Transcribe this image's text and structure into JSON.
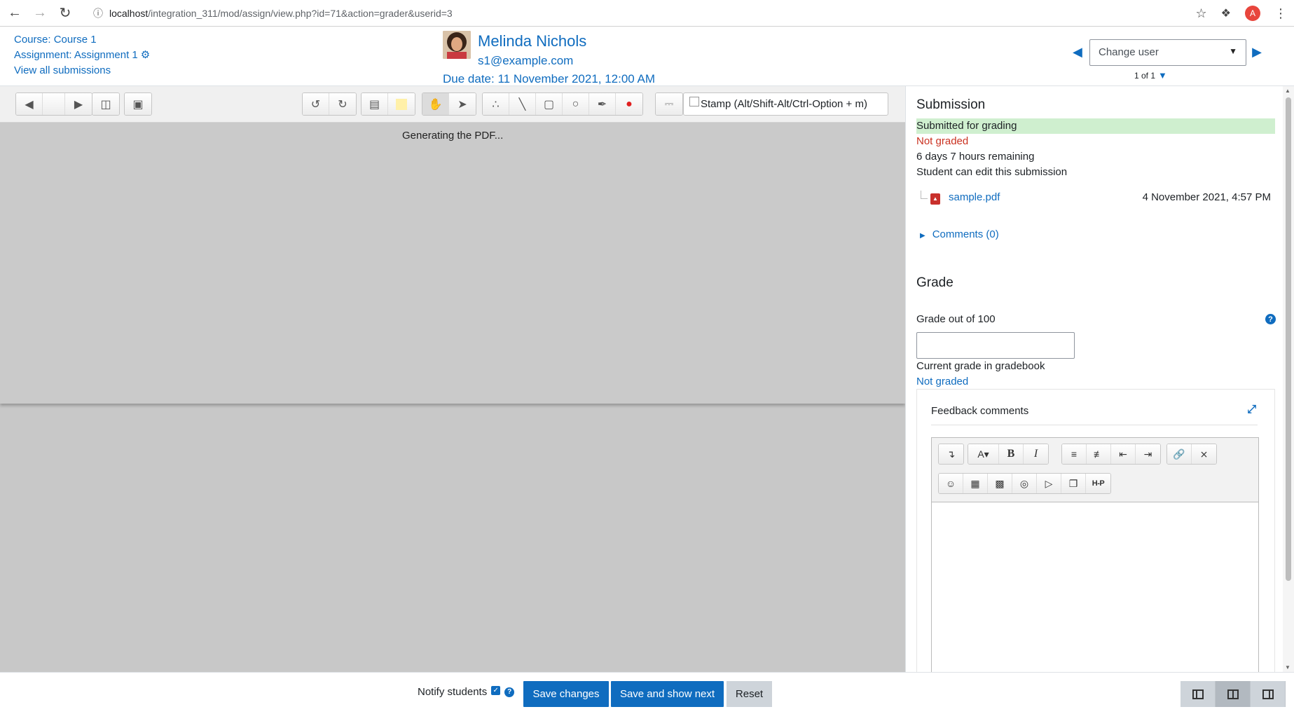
{
  "browser": {
    "url_host": "localhost",
    "url_path": "/integration_311/mod/assign/view.php?id=71&action=grader&userid=3",
    "profile_initial": "A"
  },
  "header": {
    "course_link": "Course: Course 1",
    "assignment_link": "Assignment: Assignment 1",
    "view_all": "View all submissions",
    "user_name": "Melinda Nichols",
    "user_email": "s1@example.com",
    "due_date": "Due date: 11 November 2021, 12:00 AM",
    "change_user_placeholder": "Change user",
    "user_count": "1 of 1"
  },
  "pdf": {
    "generating_message": "Generating the PDF...",
    "stamp_label": "Stamp (Alt/Shift-Alt/Ctrl-Option + m)"
  },
  "submission": {
    "heading": "Submission",
    "status_submitted": "Submitted for grading",
    "status_grading": "Not graded",
    "time_remaining": "6 days 7 hours remaining",
    "edit_status": "Student can edit this submission",
    "file_name": "sample.pdf",
    "file_date": "4 November 2021, 4:57 PM",
    "comments": "Comments (0)"
  },
  "grade": {
    "heading": "Grade",
    "grade_label": "Grade out of 100",
    "grade_value": "",
    "current_grade_label": "Current grade in gradebook",
    "current_grade_value": "Not graded",
    "feedback_title": "Feedback comments"
  },
  "footer": {
    "notify_label": "Notify students",
    "save_changes": "Save changes",
    "save_show_next": "Save and show next",
    "reset": "Reset"
  },
  "colors": {
    "brand": "#0f6cbf",
    "success_bg": "#cfefcf",
    "danger": "#ca3120"
  }
}
